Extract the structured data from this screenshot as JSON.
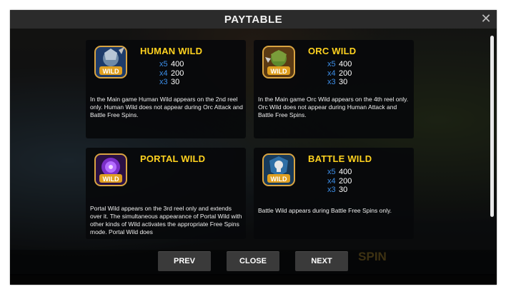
{
  "dialog": {
    "title": "PAYTABLE",
    "close_icon": "close-icon"
  },
  "cards": [
    {
      "name": "HUMAN WILD",
      "icon": "human-wild-icon",
      "pays": [
        {
          "mult": "x5",
          "amount": "400"
        },
        {
          "mult": "x4",
          "amount": "200"
        },
        {
          "mult": "x3",
          "amount": "30"
        }
      ],
      "description": "In the Main game Human Wild appears on the 2nd reel only. Human Wild does not appear during Orc Attack and Battle Free Spins."
    },
    {
      "name": "ORC WILD",
      "icon": "orc-wild-icon",
      "pays": [
        {
          "mult": "x5",
          "amount": "400"
        },
        {
          "mult": "x4",
          "amount": "200"
        },
        {
          "mult": "x3",
          "amount": "30"
        }
      ],
      "description": "In the Main game Orc Wild appears on the 4th reel only. Orc Wild does not appear during Human Attack and Battle Free Spins."
    },
    {
      "name": "PORTAL WILD",
      "icon": "portal-wild-icon",
      "pays": [],
      "description": "Portal Wild appears on the 3rd reel only and extends over it. The simultaneous appearance of Portal Wild with other kinds of Wild activates the appropriate Free Spins mode. Portal Wild does"
    },
    {
      "name": "BATTLE WILD",
      "icon": "battle-wild-icon",
      "pays": [
        {
          "mult": "x5",
          "amount": "400"
        },
        {
          "mult": "x4",
          "amount": "200"
        },
        {
          "mult": "x3",
          "amount": "30"
        }
      ],
      "description": "Battle Wild appears during Battle Free Spins only."
    }
  ],
  "wild_badge_text": "WILD",
  "buttons": {
    "prev": "PREV",
    "close": "CLOSE",
    "next": "NEXT"
  },
  "background": {
    "spin_hint": "SPIN"
  },
  "colors": {
    "title_bar": "#2b2b2b",
    "card_name": "#ffd21f",
    "multiplier": "#3c8ee8",
    "button": "#3a3a3a"
  }
}
